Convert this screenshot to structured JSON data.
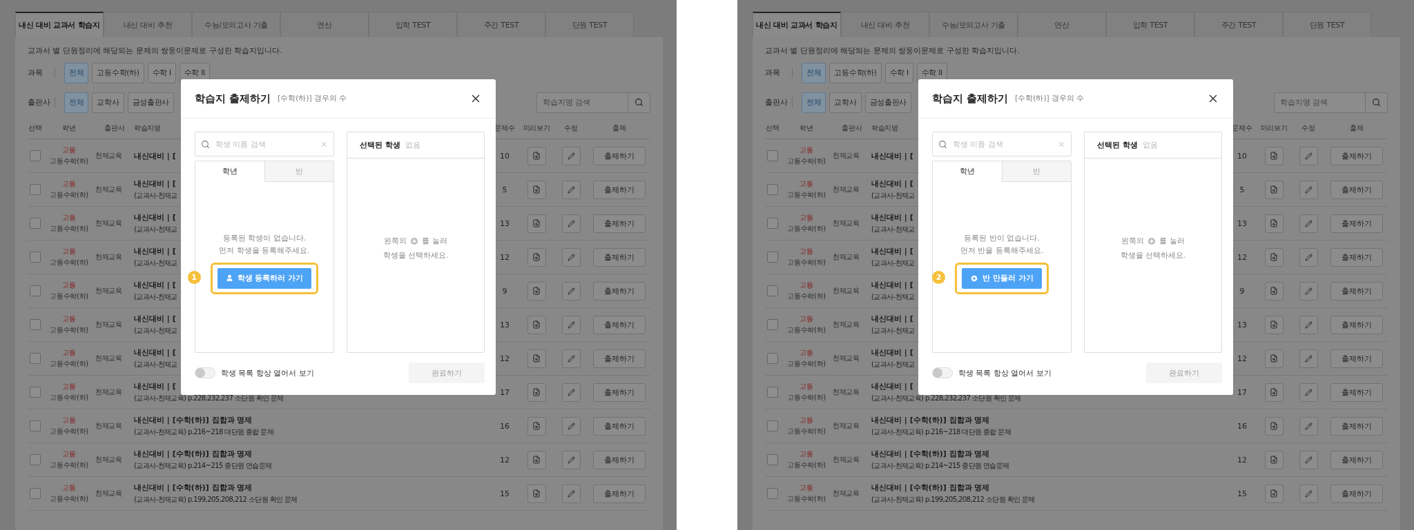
{
  "panels": [
    {
      "page": {
        "tabs": [
          {
            "label": "내신 대비 교과서 학습지",
            "selected": true
          },
          {
            "label": "내신 대비 추천",
            "selected": false
          },
          {
            "label": "수능/모의고사 기출",
            "selected": false
          },
          {
            "label": "연산",
            "selected": false
          },
          {
            "label": "입학 TEST",
            "selected": false
          },
          {
            "label": "주간 TEST",
            "selected": false
          },
          {
            "label": "단원 TEST",
            "selected": false
          }
        ],
        "description": "교과서 별 단원정리에 해당되는 문제의 쌍둥이문제로 구성한 학습지입니다.",
        "filters": [
          {
            "label": "과목",
            "options": [
              {
                "label": "전체",
                "selected": true
              },
              {
                "label": "고등수학(하)",
                "selected": false
              },
              {
                "label": "수학 I",
                "selected": false
              },
              {
                "label": "수학 II",
                "selected": false
              }
            ]
          },
          {
            "label": "출판사",
            "options": [
              {
                "label": "전체",
                "selected": true
              },
              {
                "label": "교학사",
                "selected": false
              },
              {
                "label": "금성출판사",
                "selected": false
              }
            ]
          }
        ],
        "search": {
          "placeholder": "학습지명 검색"
        },
        "columns": [
          "선택",
          "학년",
          "출판사",
          "학습지명",
          "문제수",
          "미리보기",
          "수정",
          "출제"
        ],
        "rows": [
          {
            "checked": false,
            "level": "고등",
            "course": "고등수학(하)",
            "publisher": "천재교육",
            "title": "내신대비 | [",
            "subtitle": "",
            "count": "10",
            "action": "출제하기"
          },
          {
            "checked": false,
            "level": "고등",
            "course": "고등수학(하)",
            "publisher": "천재교육",
            "title": "내신대비 | [",
            "subtitle": "(교과서-천재교",
            "count": "5",
            "action": "출제하기"
          },
          {
            "checked": false,
            "level": "고등",
            "course": "고등수학(하)",
            "publisher": "천재교육",
            "title": "내신대비 | [",
            "subtitle": "(교과서-천재교",
            "count": "13",
            "action": "출제하기"
          },
          {
            "checked": false,
            "level": "고등",
            "course": "고등수학(하)",
            "publisher": "천재교육",
            "title": "내신대비 | [",
            "subtitle": "(교과서-천재교",
            "count": "12",
            "action": "출제하기"
          },
          {
            "checked": false,
            "level": "고등",
            "course": "고등수학(하)",
            "publisher": "천재교육",
            "title": "내신대비 | [",
            "subtitle": "(교과서-천재교",
            "count": "9",
            "action": "출제하기"
          },
          {
            "checked": false,
            "level": "고등",
            "course": "고등수학(하)",
            "publisher": "천재교육",
            "title": "내신대비 | [",
            "subtitle": "(교과서-천재교",
            "count": "13",
            "action": "출제하기"
          },
          {
            "checked": false,
            "level": "고등",
            "course": "고등수학(하)",
            "publisher": "천재교육",
            "title": "내신대비 | [",
            "subtitle": "(교과서-천재교",
            "count": "12",
            "action": "출제하기"
          },
          {
            "checked": false,
            "level": "고등",
            "course": "고등수학(하)",
            "publisher": "천재교육",
            "title": "내신대비 | [",
            "subtitle": "(교과서-천재교육) p.228,232,237 소단원 확인 문제",
            "count": "17",
            "action": "출제하기"
          },
          {
            "checked": false,
            "level": "고등",
            "course": "고등수학(하)",
            "publisher": "천재교육",
            "title": "내신대비 | [수학(하)] 집합과 명제",
            "subtitle": "(교과서-천재교육) p.216~218 대단원 종합 문제",
            "count": "16",
            "action": "출제하기"
          },
          {
            "checked": false,
            "level": "고등",
            "course": "고등수학(하)",
            "publisher": "천재교육",
            "title": "내신대비 | [수학(하)] 집합과 명제",
            "subtitle": "(교과서-천재교육) p.214~215 중단원 연습문제",
            "count": "12",
            "action": "출제하기"
          },
          {
            "checked": false,
            "level": "고등",
            "course": "고등수학(하)",
            "publisher": "천재교육",
            "title": "내신대비 | [수학(하)] 집합과 명제",
            "subtitle": "(교과서-천재교육) p.199,205,208,212 소단원 확인 문제",
            "count": "15",
            "action": "출제하기"
          }
        ]
      },
      "modal": {
        "title": "학습지 출제하기",
        "subtitle": "[수학(하)] 경우의 수",
        "search": {
          "placeholder": "학생 이름 검색"
        },
        "tabs": [
          {
            "label": "학년",
            "selected": true
          },
          {
            "label": "반",
            "selected": false
          }
        ],
        "empty_lines": [
          "등록된 학생이 없습니다.",
          "먼저 학생을 등록해주세요."
        ],
        "step": "1",
        "cta": {
          "kind": "student",
          "label": "학생 등록하러 가기"
        },
        "selected_title": "선택된 학생",
        "selected_value": "없음",
        "hint_before": "왼쪽의",
        "hint_after": "를 눌러",
        "hint_line2": "학생을 선택하세요.",
        "toggle": {
          "label": "학생 목록 항상 열어서 보기",
          "on": false
        },
        "submit": {
          "label": "완료하기",
          "disabled": true
        }
      }
    },
    {
      "page": {
        "tabs": [
          {
            "label": "내신 대비 교과서 학습지",
            "selected": true
          },
          {
            "label": "내신 대비 추천",
            "selected": false
          },
          {
            "label": "수능/모의고사 기출",
            "selected": false
          },
          {
            "label": "연산",
            "selected": false
          },
          {
            "label": "입학 TEST",
            "selected": false
          },
          {
            "label": "주간 TEST",
            "selected": false
          },
          {
            "label": "단원 TEST",
            "selected": false
          }
        ],
        "description": "교과서 별 단원정리에 해당되는 문제의 쌍둥이문제로 구성한 학습지입니다.",
        "filters": [
          {
            "label": "과목",
            "options": [
              {
                "label": "전체",
                "selected": true
              },
              {
                "label": "고등수학(하)",
                "selected": false
              },
              {
                "label": "수학 I",
                "selected": false
              },
              {
                "label": "수학 II",
                "selected": false
              }
            ]
          },
          {
            "label": "출판사",
            "options": [
              {
                "label": "전체",
                "selected": true
              },
              {
                "label": "교학사",
                "selected": false
              },
              {
                "label": "금성출판사",
                "selected": false
              }
            ]
          }
        ],
        "search": {
          "placeholder": "학습지명 검색"
        },
        "columns": [
          "선택",
          "학년",
          "출판사",
          "학습지명",
          "문제수",
          "미리보기",
          "수정",
          "출제"
        ],
        "rows": [
          {
            "checked": false,
            "level": "고등",
            "course": "고등수학(하)",
            "publisher": "천재교육",
            "title": "내신대비 | [",
            "subtitle": "",
            "count": "10",
            "action": "출제하기"
          },
          {
            "checked": false,
            "level": "고등",
            "course": "고등수학(하)",
            "publisher": "천재교육",
            "title": "내신대비 | [",
            "subtitle": "(교과서-천재교",
            "count": "5",
            "action": "출제하기"
          },
          {
            "checked": false,
            "level": "고등",
            "course": "고등수학(하)",
            "publisher": "천재교육",
            "title": "내신대비 | [",
            "subtitle": "(교과서-천재교",
            "count": "13",
            "action": "출제하기"
          },
          {
            "checked": false,
            "level": "고등",
            "course": "고등수학(하)",
            "publisher": "천재교육",
            "title": "내신대비 | [",
            "subtitle": "(교과서-천재교",
            "count": "12",
            "action": "출제하기"
          },
          {
            "checked": false,
            "level": "고등",
            "course": "고등수학(하)",
            "publisher": "천재교육",
            "title": "내신대비 | [",
            "subtitle": "(교과서-천재교",
            "count": "9",
            "action": "출제하기"
          },
          {
            "checked": false,
            "level": "고등",
            "course": "고등수학(하)",
            "publisher": "천재교육",
            "title": "내신대비 | [",
            "subtitle": "(교과서-천재교",
            "count": "13",
            "action": "출제하기"
          },
          {
            "checked": false,
            "level": "고등",
            "course": "고등수학(하)",
            "publisher": "천재교육",
            "title": "내신대비 | [",
            "subtitle": "(교과서-천재교",
            "count": "12",
            "action": "출제하기"
          },
          {
            "checked": false,
            "level": "고등",
            "course": "고등수학(하)",
            "publisher": "천재교육",
            "title": "내신대비 | [",
            "subtitle": "(교과서-천재교육) p.228,232,237 소단원 확인 문제",
            "count": "17",
            "action": "출제하기"
          },
          {
            "checked": false,
            "level": "고등",
            "course": "고등수학(하)",
            "publisher": "천재교육",
            "title": "내신대비 | [수학(하)] 집합과 명제",
            "subtitle": "(교과서-천재교육) p.216~218 대단원 종합 문제",
            "count": "16",
            "action": "출제하기"
          },
          {
            "checked": false,
            "level": "고등",
            "course": "고등수학(하)",
            "publisher": "천재교육",
            "title": "내신대비 | [수학(하)] 집합과 명제",
            "subtitle": "(교과서-천재교육) p.214~215 중단원 연습문제",
            "count": "12",
            "action": "출제하기"
          },
          {
            "checked": false,
            "level": "고등",
            "course": "고등수학(하)",
            "publisher": "천재교육",
            "title": "내신대비 | [수학(하)] 집합과 명제",
            "subtitle": "(교과서-천재교육) p.199,205,208,212 소단원 확인 문제",
            "count": "15",
            "action": "출제하기"
          }
        ]
      },
      "modal": {
        "title": "학습지 출제하기",
        "subtitle": "[수학(하)] 경우의 수",
        "search": {
          "placeholder": "학생 이름 검색"
        },
        "tabs": [
          {
            "label": "학년",
            "selected": true
          },
          {
            "label": "반",
            "selected": false
          }
        ],
        "empty_lines": [
          "등록된 반이 없습니다.",
          "먼저 반을 등록해주세요."
        ],
        "step": "2",
        "cta": {
          "kind": "class",
          "label": "반 만들러 가기"
        },
        "selected_title": "선택된 학생",
        "selected_value": "없음",
        "hint_before": "왼쪽의",
        "hint_after": "를 눌러",
        "hint_line2": "학생을 선택하세요.",
        "toggle": {
          "label": "학생 목록 항상 열어서 보기",
          "on": false
        },
        "submit": {
          "label": "완료하기",
          "disabled": true
        }
      }
    }
  ]
}
